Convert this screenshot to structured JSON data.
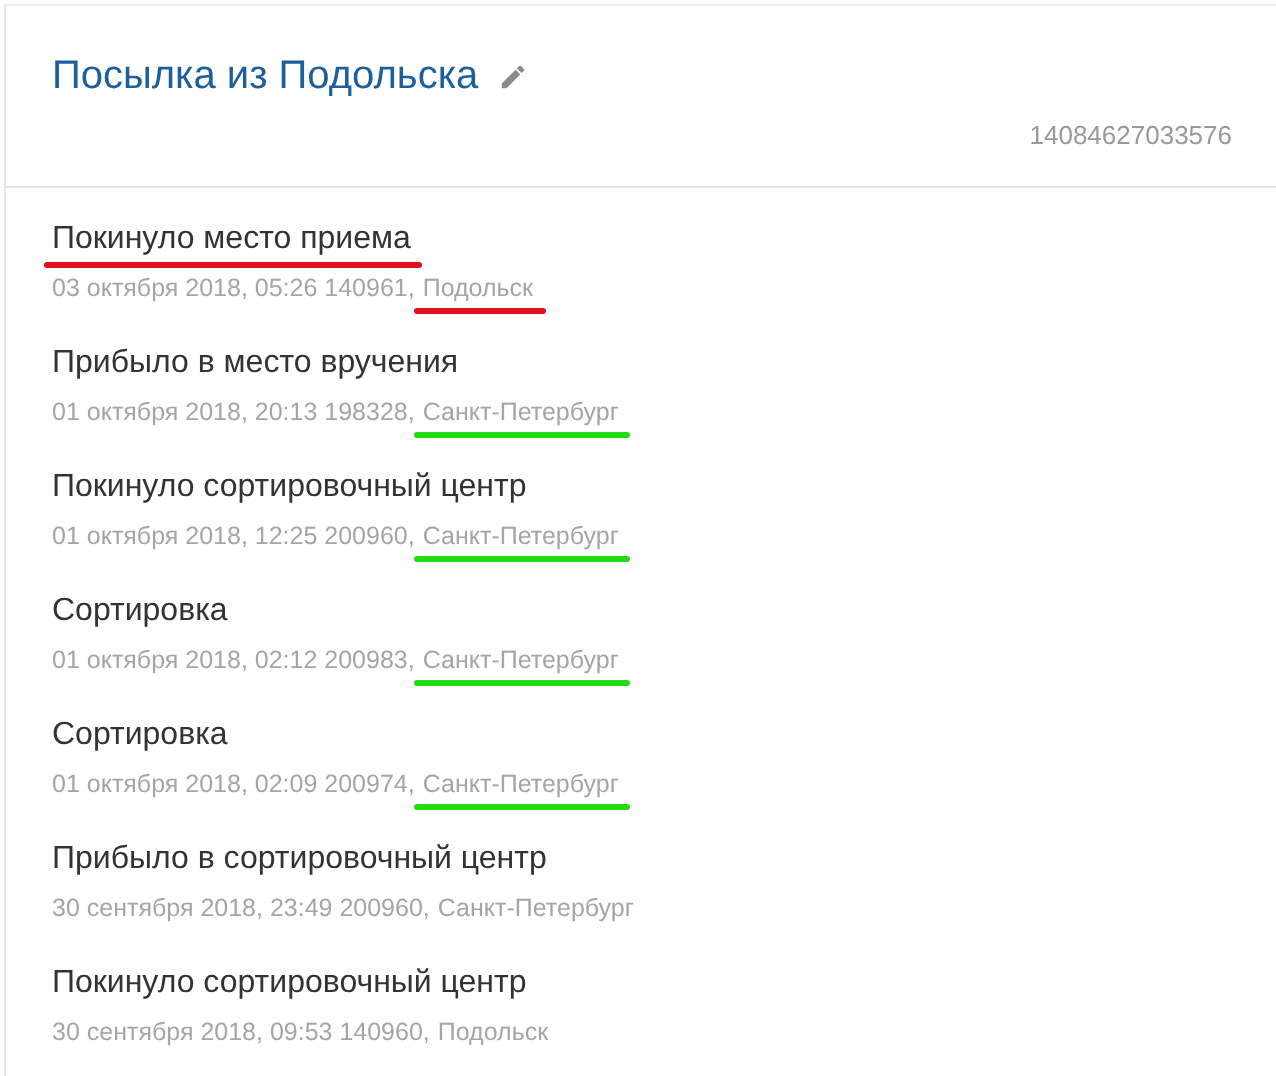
{
  "parcel": {
    "title": "Посылка из Подольска",
    "barcode": "14084627033576"
  },
  "events": [
    {
      "status": "Покинуло место приема",
      "details": "03 октября 2018, 05:26 140961,",
      "city": "Подольск",
      "marks": [
        {
          "kind": "status",
          "color": "#e0101c"
        },
        {
          "kind": "city",
          "color": "#e0101c"
        }
      ]
    },
    {
      "status": "Прибыло в место вручения",
      "details": "01 октября 2018, 20:13 198328,",
      "city": "Санкт-Петербург",
      "marks": [
        {
          "kind": "city",
          "color": "#22dd11"
        }
      ]
    },
    {
      "status": "Покинуло сортировочный центр",
      "details": "01 октября 2018, 12:25 200960,",
      "city": "Санкт-Петербург",
      "marks": [
        {
          "kind": "city",
          "color": "#22dd11"
        }
      ]
    },
    {
      "status": "Сортировка",
      "details": "01 октября 2018, 02:12 200983,",
      "city": "Санкт-Петербург",
      "marks": [
        {
          "kind": "city",
          "color": "#22dd11"
        }
      ]
    },
    {
      "status": "Сортировка",
      "details": "01 октября 2018, 02:09 200974,",
      "city": "Санкт-Петербург",
      "marks": [
        {
          "kind": "city",
          "color": "#22dd11"
        }
      ]
    },
    {
      "status": "Прибыло в сортировочный центр",
      "details": "30 сентября 2018, 23:49 200960,",
      "city": "Санкт-Петербург"
    },
    {
      "status": "Покинуло сортировочный центр",
      "details": "30 сентября 2018, 09:53 140960,",
      "city": "Подольск"
    }
  ]
}
